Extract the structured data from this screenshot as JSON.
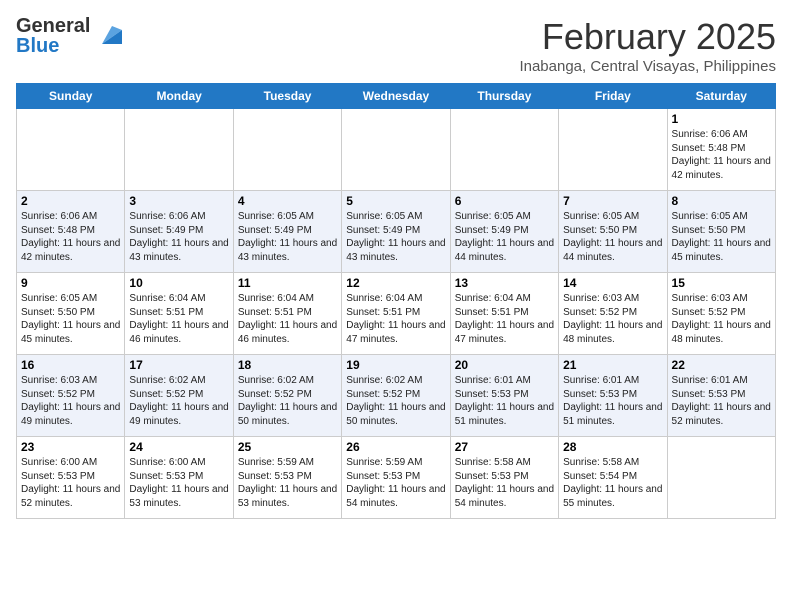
{
  "header": {
    "logo_line1": "General",
    "logo_line2": "Blue",
    "month_year": "February 2025",
    "location": "Inabanga, Central Visayas, Philippines"
  },
  "weekdays": [
    "Sunday",
    "Monday",
    "Tuesday",
    "Wednesday",
    "Thursday",
    "Friday",
    "Saturday"
  ],
  "weeks": [
    {
      "days": [
        {
          "num": "",
          "info": ""
        },
        {
          "num": "",
          "info": ""
        },
        {
          "num": "",
          "info": ""
        },
        {
          "num": "",
          "info": ""
        },
        {
          "num": "",
          "info": ""
        },
        {
          "num": "",
          "info": ""
        },
        {
          "num": "1",
          "info": "Sunrise: 6:06 AM\nSunset: 5:48 PM\nDaylight: 11 hours and 42 minutes."
        }
      ]
    },
    {
      "days": [
        {
          "num": "2",
          "info": "Sunrise: 6:06 AM\nSunset: 5:48 PM\nDaylight: 11 hours and 42 minutes."
        },
        {
          "num": "3",
          "info": "Sunrise: 6:06 AM\nSunset: 5:49 PM\nDaylight: 11 hours and 43 minutes."
        },
        {
          "num": "4",
          "info": "Sunrise: 6:05 AM\nSunset: 5:49 PM\nDaylight: 11 hours and 43 minutes."
        },
        {
          "num": "5",
          "info": "Sunrise: 6:05 AM\nSunset: 5:49 PM\nDaylight: 11 hours and 43 minutes."
        },
        {
          "num": "6",
          "info": "Sunrise: 6:05 AM\nSunset: 5:49 PM\nDaylight: 11 hours and 44 minutes."
        },
        {
          "num": "7",
          "info": "Sunrise: 6:05 AM\nSunset: 5:50 PM\nDaylight: 11 hours and 44 minutes."
        },
        {
          "num": "8",
          "info": "Sunrise: 6:05 AM\nSunset: 5:50 PM\nDaylight: 11 hours and 45 minutes."
        }
      ]
    },
    {
      "days": [
        {
          "num": "9",
          "info": "Sunrise: 6:05 AM\nSunset: 5:50 PM\nDaylight: 11 hours and 45 minutes."
        },
        {
          "num": "10",
          "info": "Sunrise: 6:04 AM\nSunset: 5:51 PM\nDaylight: 11 hours and 46 minutes."
        },
        {
          "num": "11",
          "info": "Sunrise: 6:04 AM\nSunset: 5:51 PM\nDaylight: 11 hours and 46 minutes."
        },
        {
          "num": "12",
          "info": "Sunrise: 6:04 AM\nSunset: 5:51 PM\nDaylight: 11 hours and 47 minutes."
        },
        {
          "num": "13",
          "info": "Sunrise: 6:04 AM\nSunset: 5:51 PM\nDaylight: 11 hours and 47 minutes."
        },
        {
          "num": "14",
          "info": "Sunrise: 6:03 AM\nSunset: 5:52 PM\nDaylight: 11 hours and 48 minutes."
        },
        {
          "num": "15",
          "info": "Sunrise: 6:03 AM\nSunset: 5:52 PM\nDaylight: 11 hours and 48 minutes."
        }
      ]
    },
    {
      "days": [
        {
          "num": "16",
          "info": "Sunrise: 6:03 AM\nSunset: 5:52 PM\nDaylight: 11 hours and 49 minutes."
        },
        {
          "num": "17",
          "info": "Sunrise: 6:02 AM\nSunset: 5:52 PM\nDaylight: 11 hours and 49 minutes."
        },
        {
          "num": "18",
          "info": "Sunrise: 6:02 AM\nSunset: 5:52 PM\nDaylight: 11 hours and 50 minutes."
        },
        {
          "num": "19",
          "info": "Sunrise: 6:02 AM\nSunset: 5:52 PM\nDaylight: 11 hours and 50 minutes."
        },
        {
          "num": "20",
          "info": "Sunrise: 6:01 AM\nSunset: 5:53 PM\nDaylight: 11 hours and 51 minutes."
        },
        {
          "num": "21",
          "info": "Sunrise: 6:01 AM\nSunset: 5:53 PM\nDaylight: 11 hours and 51 minutes."
        },
        {
          "num": "22",
          "info": "Sunrise: 6:01 AM\nSunset: 5:53 PM\nDaylight: 11 hours and 52 minutes."
        }
      ]
    },
    {
      "days": [
        {
          "num": "23",
          "info": "Sunrise: 6:00 AM\nSunset: 5:53 PM\nDaylight: 11 hours and 52 minutes."
        },
        {
          "num": "24",
          "info": "Sunrise: 6:00 AM\nSunset: 5:53 PM\nDaylight: 11 hours and 53 minutes."
        },
        {
          "num": "25",
          "info": "Sunrise: 5:59 AM\nSunset: 5:53 PM\nDaylight: 11 hours and 53 minutes."
        },
        {
          "num": "26",
          "info": "Sunrise: 5:59 AM\nSunset: 5:53 PM\nDaylight: 11 hours and 54 minutes."
        },
        {
          "num": "27",
          "info": "Sunrise: 5:58 AM\nSunset: 5:53 PM\nDaylight: 11 hours and 54 minutes."
        },
        {
          "num": "28",
          "info": "Sunrise: 5:58 AM\nSunset: 5:54 PM\nDaylight: 11 hours and 55 minutes."
        },
        {
          "num": "",
          "info": ""
        }
      ]
    }
  ]
}
